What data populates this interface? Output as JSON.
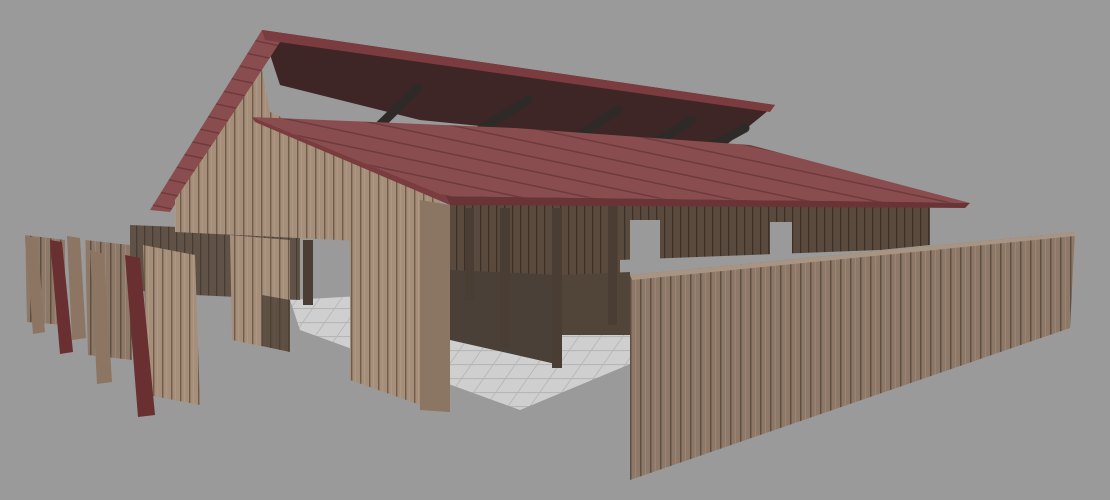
{
  "scene": {
    "subject": "barn-model",
    "background": "#9a9a9a",
    "colors": {
      "wood_light": "#a58f7a",
      "wood_mid": "#8c7460",
      "wood_dark": "#5a4a3e",
      "interior_dark": "#4a4038",
      "roof_red": "#8a4d4f",
      "roof_dark": "#3e2526",
      "fascia": "#7a3c3e",
      "post_red": "#6a2f30",
      "grid_floor": "#cfcfcf",
      "grid_line": "#b4b4b4"
    }
  }
}
